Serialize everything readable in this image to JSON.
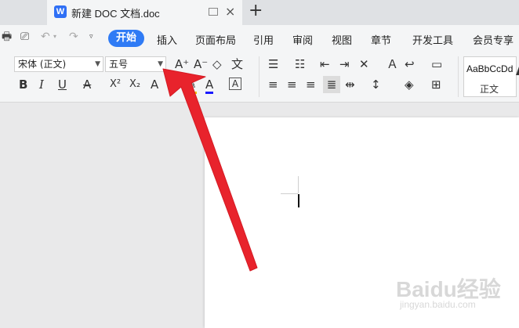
{
  "tabs": {
    "document_title": "新建 DOC 文档.doc",
    "app_icon_letter": "W",
    "close_symbol": "×",
    "new_tab_symbol": "+"
  },
  "menu": {
    "items": [
      "开始",
      "插入",
      "页面布局",
      "引用",
      "审阅",
      "视图",
      "章节",
      "开发工具",
      "会员专享"
    ],
    "active_index": 0
  },
  "ribbon": {
    "font_name": "宋体 (正文)",
    "font_size": "五号",
    "style_sample": "AaBbCcDd",
    "style_name": "正文",
    "extra_glyph": "A"
  },
  "colors": {
    "accent": "#2f7bf5",
    "annotation_arrow": "#e8232c",
    "font_color_underline": "#1a1aff",
    "highlight_underline": "#f2c200"
  },
  "watermark": {
    "main": "Baidu经验",
    "sub": "jingyan.baidu.com"
  }
}
